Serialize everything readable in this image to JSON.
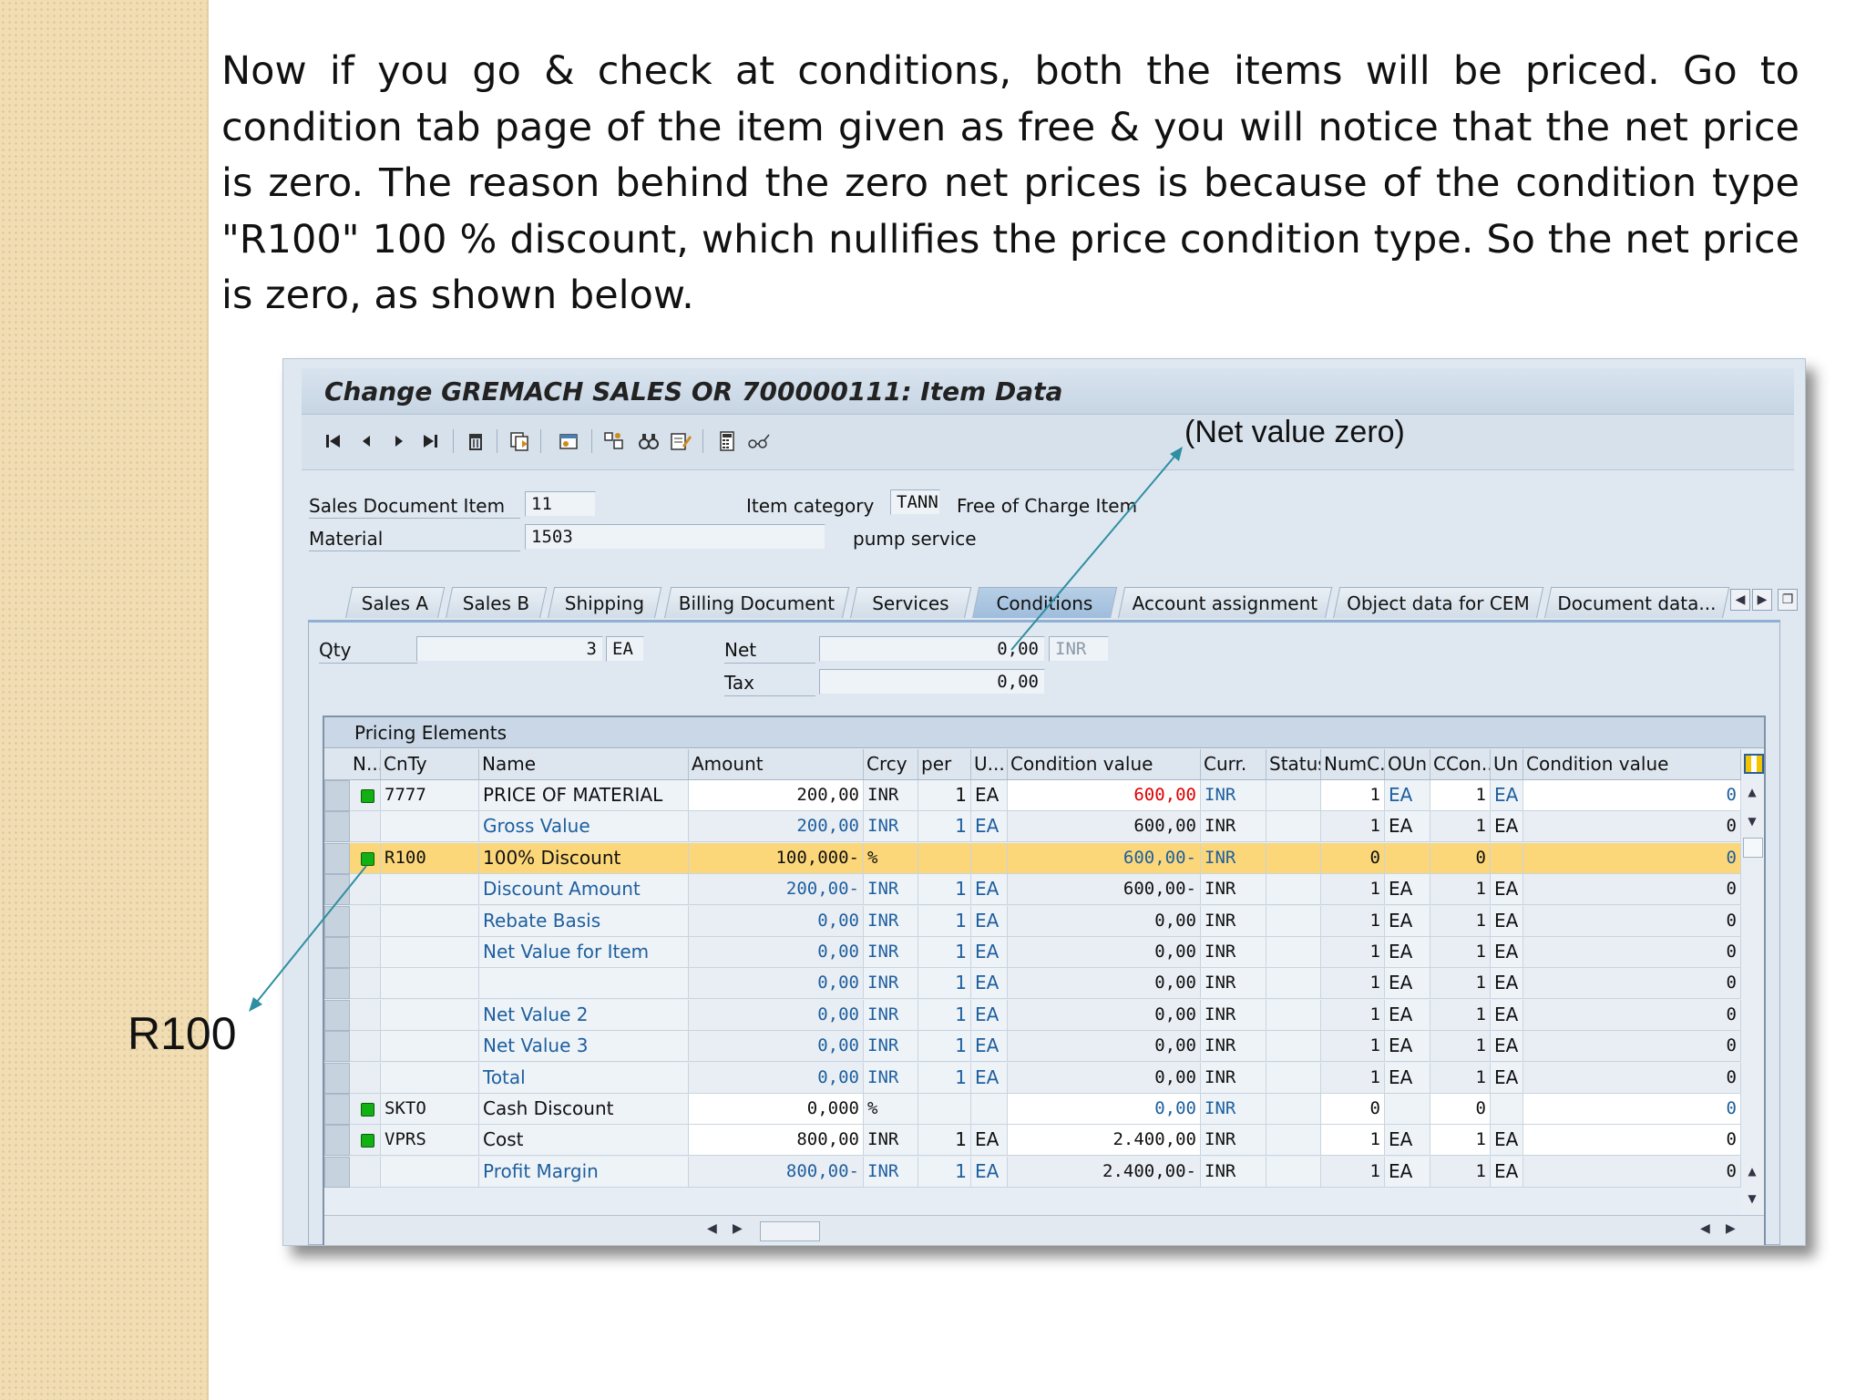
{
  "intro_text": "Now if you go & check at conditions, both the items will be priced. Go to condition tab page of the item given as free & you will notice that the net price is zero. The reason behind the zero net prices is because of the condition type \"R100\" 100 % discount, which nullifies the price condition type. So the net price is zero, as shown below.",
  "annotations": {
    "net_value": "(Net value zero)",
    "r100": "R100"
  },
  "window": {
    "title": "Change GREMACH SALES OR 700000111: Item Data"
  },
  "toolbar": {
    "icons": [
      "first-page-icon",
      "prev-page-icon",
      "next-page-icon",
      "last-page-icon",
      "delete-icon",
      "copy-icon",
      "header-icon",
      "configure-icon",
      "binoculars-icon",
      "edit-notes-icon",
      "calculator-icon",
      "glasses-icon"
    ]
  },
  "item": {
    "sales_doc_item_label": "Sales Document Item",
    "sales_doc_item": "11",
    "item_category_label": "Item category",
    "item_category": "TANN",
    "item_category_desc": "Free of Charge Item",
    "material_label": "Material",
    "material": "1503",
    "material_desc": "pump service"
  },
  "tabs": [
    "Sales A",
    "Sales B",
    "Shipping",
    "Billing Document",
    "Services",
    "Conditions",
    "Account assignment",
    "Object data for CEM",
    "Document data..."
  ],
  "active_tab": "Conditions",
  "conditions": {
    "qty_label": "Qty",
    "qty": "3",
    "qty_unit": "EA",
    "net_label": "Net",
    "net": "0,00",
    "net_currency": "INR",
    "tax_label": "Tax",
    "tax": "0,00"
  },
  "pricing": {
    "title": "Pricing Elements",
    "columns": [
      "N...",
      "CnTy",
      "Name",
      "Amount",
      "Crcy",
      "per",
      "U...",
      "Condition value",
      "Curr.",
      "Status",
      "NumC...",
      "OUn",
      "CCon...",
      "Un",
      "Condition value"
    ],
    "rows": [
      {
        "led": true,
        "cnty": "7777",
        "name": "PRICE OF MATERIAL",
        "amount": "200,00",
        "crcy": "INR",
        "per": "1",
        "uom": "EA",
        "cond_value": "600,00",
        "curr": "INR",
        "status": "",
        "numc": "1",
        "oun": "EA",
        "ccon": "1",
        "un": "EA",
        "cond_value2": "0",
        "style": "normal"
      },
      {
        "led": false,
        "cnty": "",
        "name": "Gross Value",
        "amount": "200,00",
        "crcy": "INR",
        "per": "1",
        "uom": "EA",
        "cond_value": "600,00",
        "curr": "INR",
        "status": "",
        "numc": "1",
        "oun": "EA",
        "ccon": "1",
        "un": "EA",
        "cond_value2": "0",
        "style": "subtotal"
      },
      {
        "led": true,
        "cnty": "R100",
        "name": "100% Discount",
        "amount": "100,000-",
        "crcy": "%",
        "per": "",
        "uom": "",
        "cond_value": "600,00-",
        "curr": "INR",
        "status": "",
        "numc": "0",
        "oun": "",
        "ccon": "0",
        "un": "",
        "cond_value2": "0",
        "style": "selected"
      },
      {
        "led": false,
        "cnty": "",
        "name": "Discount Amount",
        "amount": "200,00-",
        "crcy": "INR",
        "per": "1",
        "uom": "EA",
        "cond_value": "600,00-",
        "curr": "INR",
        "status": "",
        "numc": "1",
        "oun": "EA",
        "ccon": "1",
        "un": "EA",
        "cond_value2": "0",
        "style": "subtotal"
      },
      {
        "led": false,
        "cnty": "",
        "name": "Rebate Basis",
        "amount": "0,00",
        "crcy": "INR",
        "per": "1",
        "uom": "EA",
        "cond_value": "0,00",
        "curr": "INR",
        "status": "",
        "numc": "1",
        "oun": "EA",
        "ccon": "1",
        "un": "EA",
        "cond_value2": "0",
        "style": "subtotal"
      },
      {
        "led": false,
        "cnty": "",
        "name": "Net Value for Item",
        "amount": "0,00",
        "crcy": "INR",
        "per": "1",
        "uom": "EA",
        "cond_value": "0,00",
        "curr": "INR",
        "status": "",
        "numc": "1",
        "oun": "EA",
        "ccon": "1",
        "un": "EA",
        "cond_value2": "0",
        "style": "subtotal"
      },
      {
        "led": false,
        "cnty": "",
        "name": "",
        "amount": "0,00",
        "crcy": "INR",
        "per": "1",
        "uom": "EA",
        "cond_value": "0,00",
        "curr": "INR",
        "status": "",
        "numc": "1",
        "oun": "EA",
        "ccon": "1",
        "un": "EA",
        "cond_value2": "0",
        "style": "subtotal"
      },
      {
        "led": false,
        "cnty": "",
        "name": "Net Value 2",
        "amount": "0,00",
        "crcy": "INR",
        "per": "1",
        "uom": "EA",
        "cond_value": "0,00",
        "curr": "INR",
        "status": "",
        "numc": "1",
        "oun": "EA",
        "ccon": "1",
        "un": "EA",
        "cond_value2": "0",
        "style": "subtotal"
      },
      {
        "led": false,
        "cnty": "",
        "name": "Net Value 3",
        "amount": "0,00",
        "crcy": "INR",
        "per": "1",
        "uom": "EA",
        "cond_value": "0,00",
        "curr": "INR",
        "status": "",
        "numc": "1",
        "oun": "EA",
        "ccon": "1",
        "un": "EA",
        "cond_value2": "0",
        "style": "subtotal"
      },
      {
        "led": false,
        "cnty": "",
        "name": "Total",
        "amount": "0,00",
        "crcy": "INR",
        "per": "1",
        "uom": "EA",
        "cond_value": "0,00",
        "curr": "INR",
        "status": "",
        "numc": "1",
        "oun": "EA",
        "ccon": "1",
        "un": "EA",
        "cond_value2": "0",
        "style": "subtotal"
      },
      {
        "led": true,
        "cnty": "SKTO",
        "name": "Cash Discount",
        "amount": "0,000",
        "crcy": "%",
        "per": "",
        "uom": "",
        "cond_value": "0,00",
        "curr": "INR",
        "status": "",
        "numc": "0",
        "oun": "",
        "ccon": "0",
        "un": "",
        "cond_value2": "0",
        "style": "inactive"
      },
      {
        "led": true,
        "cnty": "VPRS",
        "name": "Cost",
        "amount": "800,00",
        "crcy": "INR",
        "per": "1",
        "uom": "EA",
        "cond_value": "2.400,00",
        "curr": "INR",
        "status": "",
        "numc": "1",
        "oun": "EA",
        "ccon": "1",
        "un": "EA",
        "cond_value2": "0",
        "style": "normal"
      },
      {
        "led": false,
        "cnty": "",
        "name": "Profit Margin",
        "amount": "800,00-",
        "crcy": "INR",
        "per": "1",
        "uom": "EA",
        "cond_value": "2.400,00-",
        "curr": "INR",
        "status": "",
        "numc": "1",
        "oun": "EA",
        "ccon": "1",
        "un": "EA",
        "cond_value2": "0",
        "style": "subtotal"
      }
    ]
  },
  "colors": {
    "selected_row": "#fcd77a",
    "subtotal_text": "#1e5f9e",
    "highlight_red": "#e00000",
    "arrow": "#2f8ea0"
  }
}
